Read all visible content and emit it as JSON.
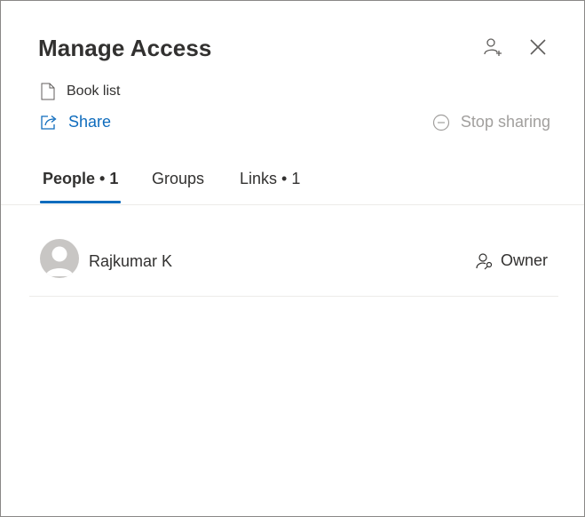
{
  "dialog": {
    "title": "Manage Access",
    "file_name": "Book list",
    "share_label": "Share",
    "stop_sharing_label": "Stop sharing"
  },
  "tabs": [
    {
      "label": "People • 1",
      "active": true
    },
    {
      "label": "Groups",
      "active": false
    },
    {
      "label": "Links • 1",
      "active": false
    }
  ],
  "people": [
    {
      "name": "Rajkumar K",
      "role": "Owner"
    }
  ],
  "colors": {
    "accent": "#0f6cbd",
    "disabled_text": "#a19f9d",
    "avatar_bg": "#c8c6c4"
  },
  "icons": {
    "header_actions": [
      "add-person-icon",
      "close-icon"
    ],
    "file": "document-icon",
    "share": "share-icon",
    "stop_sharing": "stop-circle-icon",
    "role": "people-key-icon"
  }
}
